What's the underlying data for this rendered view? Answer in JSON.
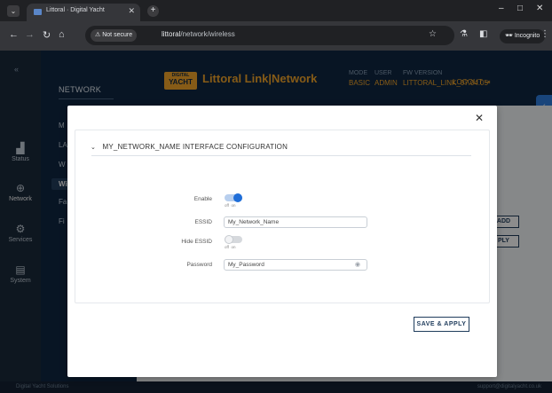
{
  "browser": {
    "tab_title": "Littoral · Digital Yacht",
    "not_secure": "Not secure",
    "url_host": "littoral",
    "url_path": "/network/wireless",
    "incognito": "Incognito"
  },
  "sidebar": {
    "items": [
      {
        "label": "Status"
      },
      {
        "label": "Network"
      },
      {
        "label": "Services"
      },
      {
        "label": "System"
      }
    ]
  },
  "subnav": {
    "title": "NETWORK",
    "items": [
      "M",
      "LA",
      "W",
      "Wi",
      "Fa",
      "Fi"
    ]
  },
  "header": {
    "logo_top": "DIGITAL",
    "logo_main": "YACHT",
    "product": "Littoral Link|Network",
    "mode_label": "MODE",
    "mode_value": "BASIC",
    "user_label": "USER",
    "user_value": "ADMIN",
    "fw_label": "FW VERSION",
    "fw_value": "LITTORAL_LINK_07.04.05",
    "logout": "LOGOUT"
  },
  "background": {
    "btn_add": "ADD",
    "btn_apply": "PLY"
  },
  "footer": {
    "left": "Digital Yacht Solutions",
    "right": "support@digitalyacht.co.uk"
  },
  "modal": {
    "section_title": "MY_NETWORK_NAME INTERFACE CONFIGURATION",
    "enable_label": "Enable",
    "enable_on": true,
    "essid_label": "ESSID",
    "essid_value": "My_Network_Name",
    "hide_essid_label": "Hide ESSID",
    "hide_essid_on": false,
    "password_label": "Password",
    "password_value": "My_Password",
    "toggle_off_text": "off",
    "toggle_on_text": "on",
    "save_label": "SAVE & APPLY"
  }
}
